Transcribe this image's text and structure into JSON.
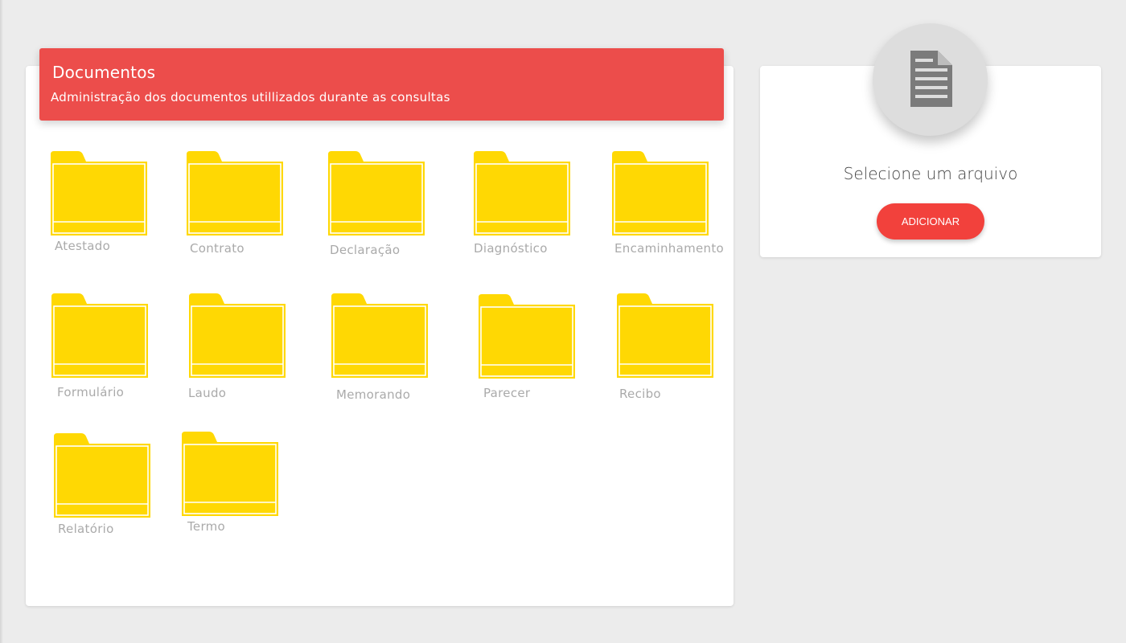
{
  "header": {
    "title": "Documentos",
    "subtitle": "Administração dos documentos utillizados durante as consultas"
  },
  "folders": [
    {
      "label": "Atestado",
      "icon": "folder-icon"
    },
    {
      "label": "Contrato",
      "icon": "folder-icon"
    },
    {
      "label": "Declaração",
      "icon": "folder-icon"
    },
    {
      "label": "Diagnóstico",
      "icon": "folder-icon"
    },
    {
      "label": "Encaminhamento",
      "icon": "folder-icon"
    },
    {
      "label": "Formulário",
      "icon": "folder-icon"
    },
    {
      "label": "Laudo",
      "icon": "folder-icon"
    },
    {
      "label": "Memorando",
      "icon": "folder-icon"
    },
    {
      "label": "Parecer",
      "icon": "folder-icon"
    },
    {
      "label": "Recibo",
      "icon": "folder-icon"
    },
    {
      "label": "Relatório",
      "icon": "folder-icon"
    },
    {
      "label": "Termo",
      "icon": "folder-icon"
    }
  ],
  "side_panel": {
    "icon": "document-icon",
    "prompt": "Selecione um arquivo",
    "add_label": "ADICIONAR"
  },
  "colors": {
    "accent": "#ec4d4b",
    "button": "#f2413c",
    "folder": "#ffd803"
  }
}
